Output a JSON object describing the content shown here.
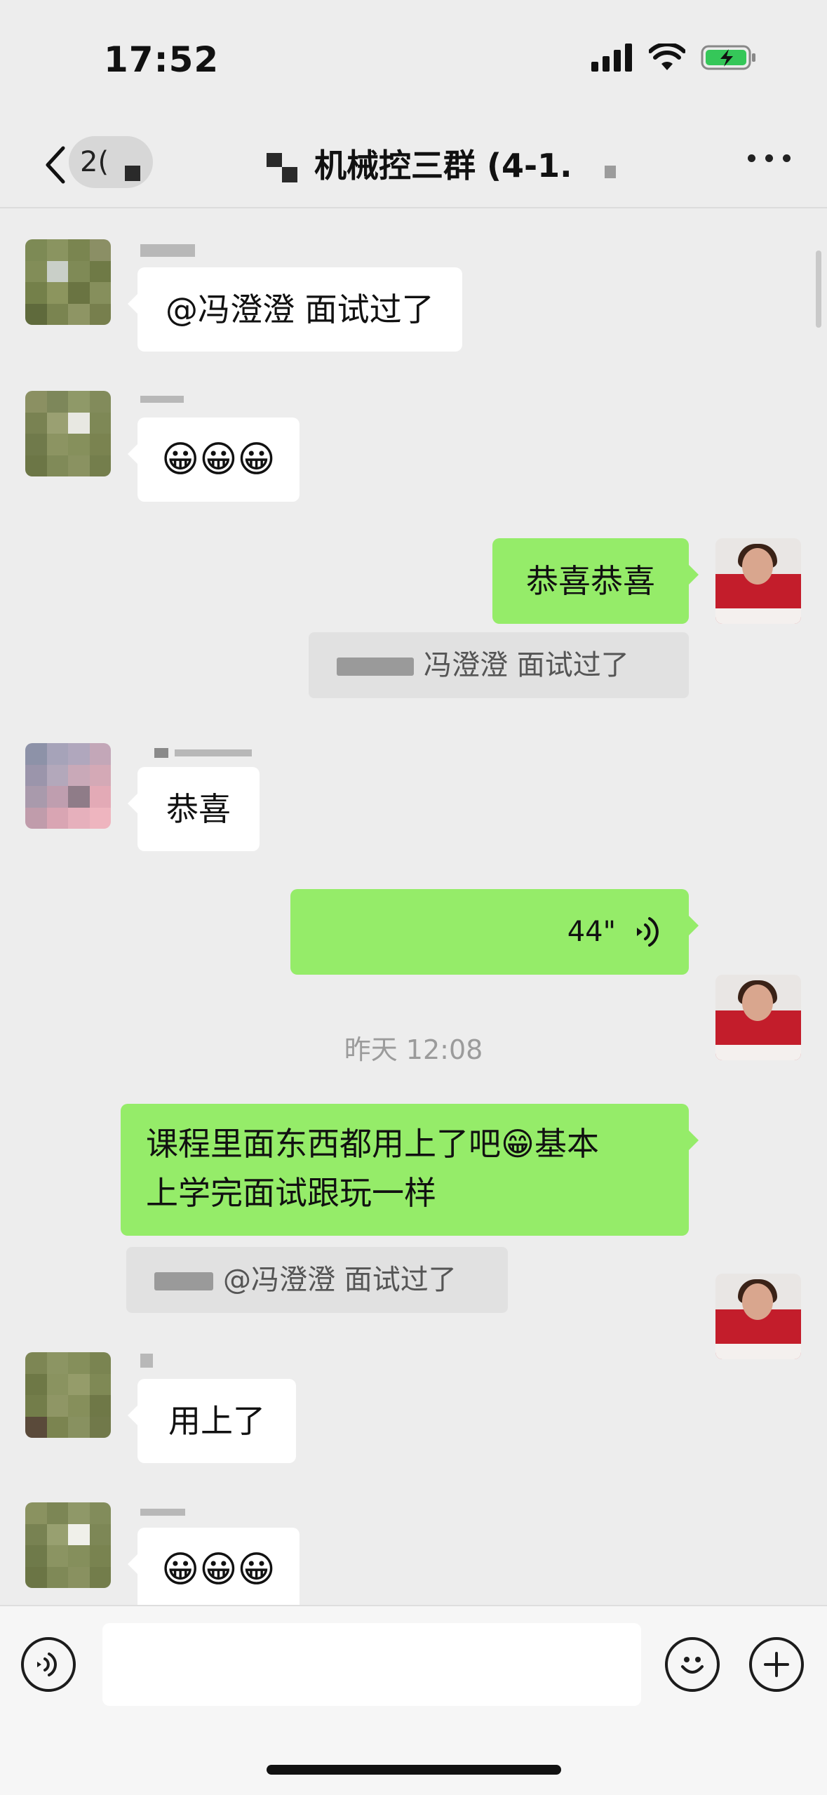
{
  "status_bar": {
    "time": "17:52"
  },
  "nav": {
    "unread_count": "2(",
    "title": "机械控三群 (4-1.",
    "more_icon": "more-dots-icon"
  },
  "messages": {
    "m1": {
      "text": "@冯澄澄 面试过了"
    },
    "m2": {
      "text": "😀😀😀"
    },
    "m3": {
      "text": "恭喜恭喜",
      "quote": "冯澄澄 面试过了"
    },
    "m4": {
      "text": "恭喜"
    },
    "m5": {
      "duration": "44\""
    },
    "timestamp": "昨天 12:08",
    "m6": {
      "line1": "课程里面东西都用上了吧😁基本",
      "line2": "上学完面试跟玩一样",
      "quote": "@冯澄澄 面试过了"
    },
    "m7": {
      "text": "用上了"
    },
    "m8": {
      "text": "😀😀😀"
    }
  },
  "colors": {
    "sent_bubble": "#95ec69",
    "received_bubble": "#ffffff",
    "background": "#ededed"
  }
}
